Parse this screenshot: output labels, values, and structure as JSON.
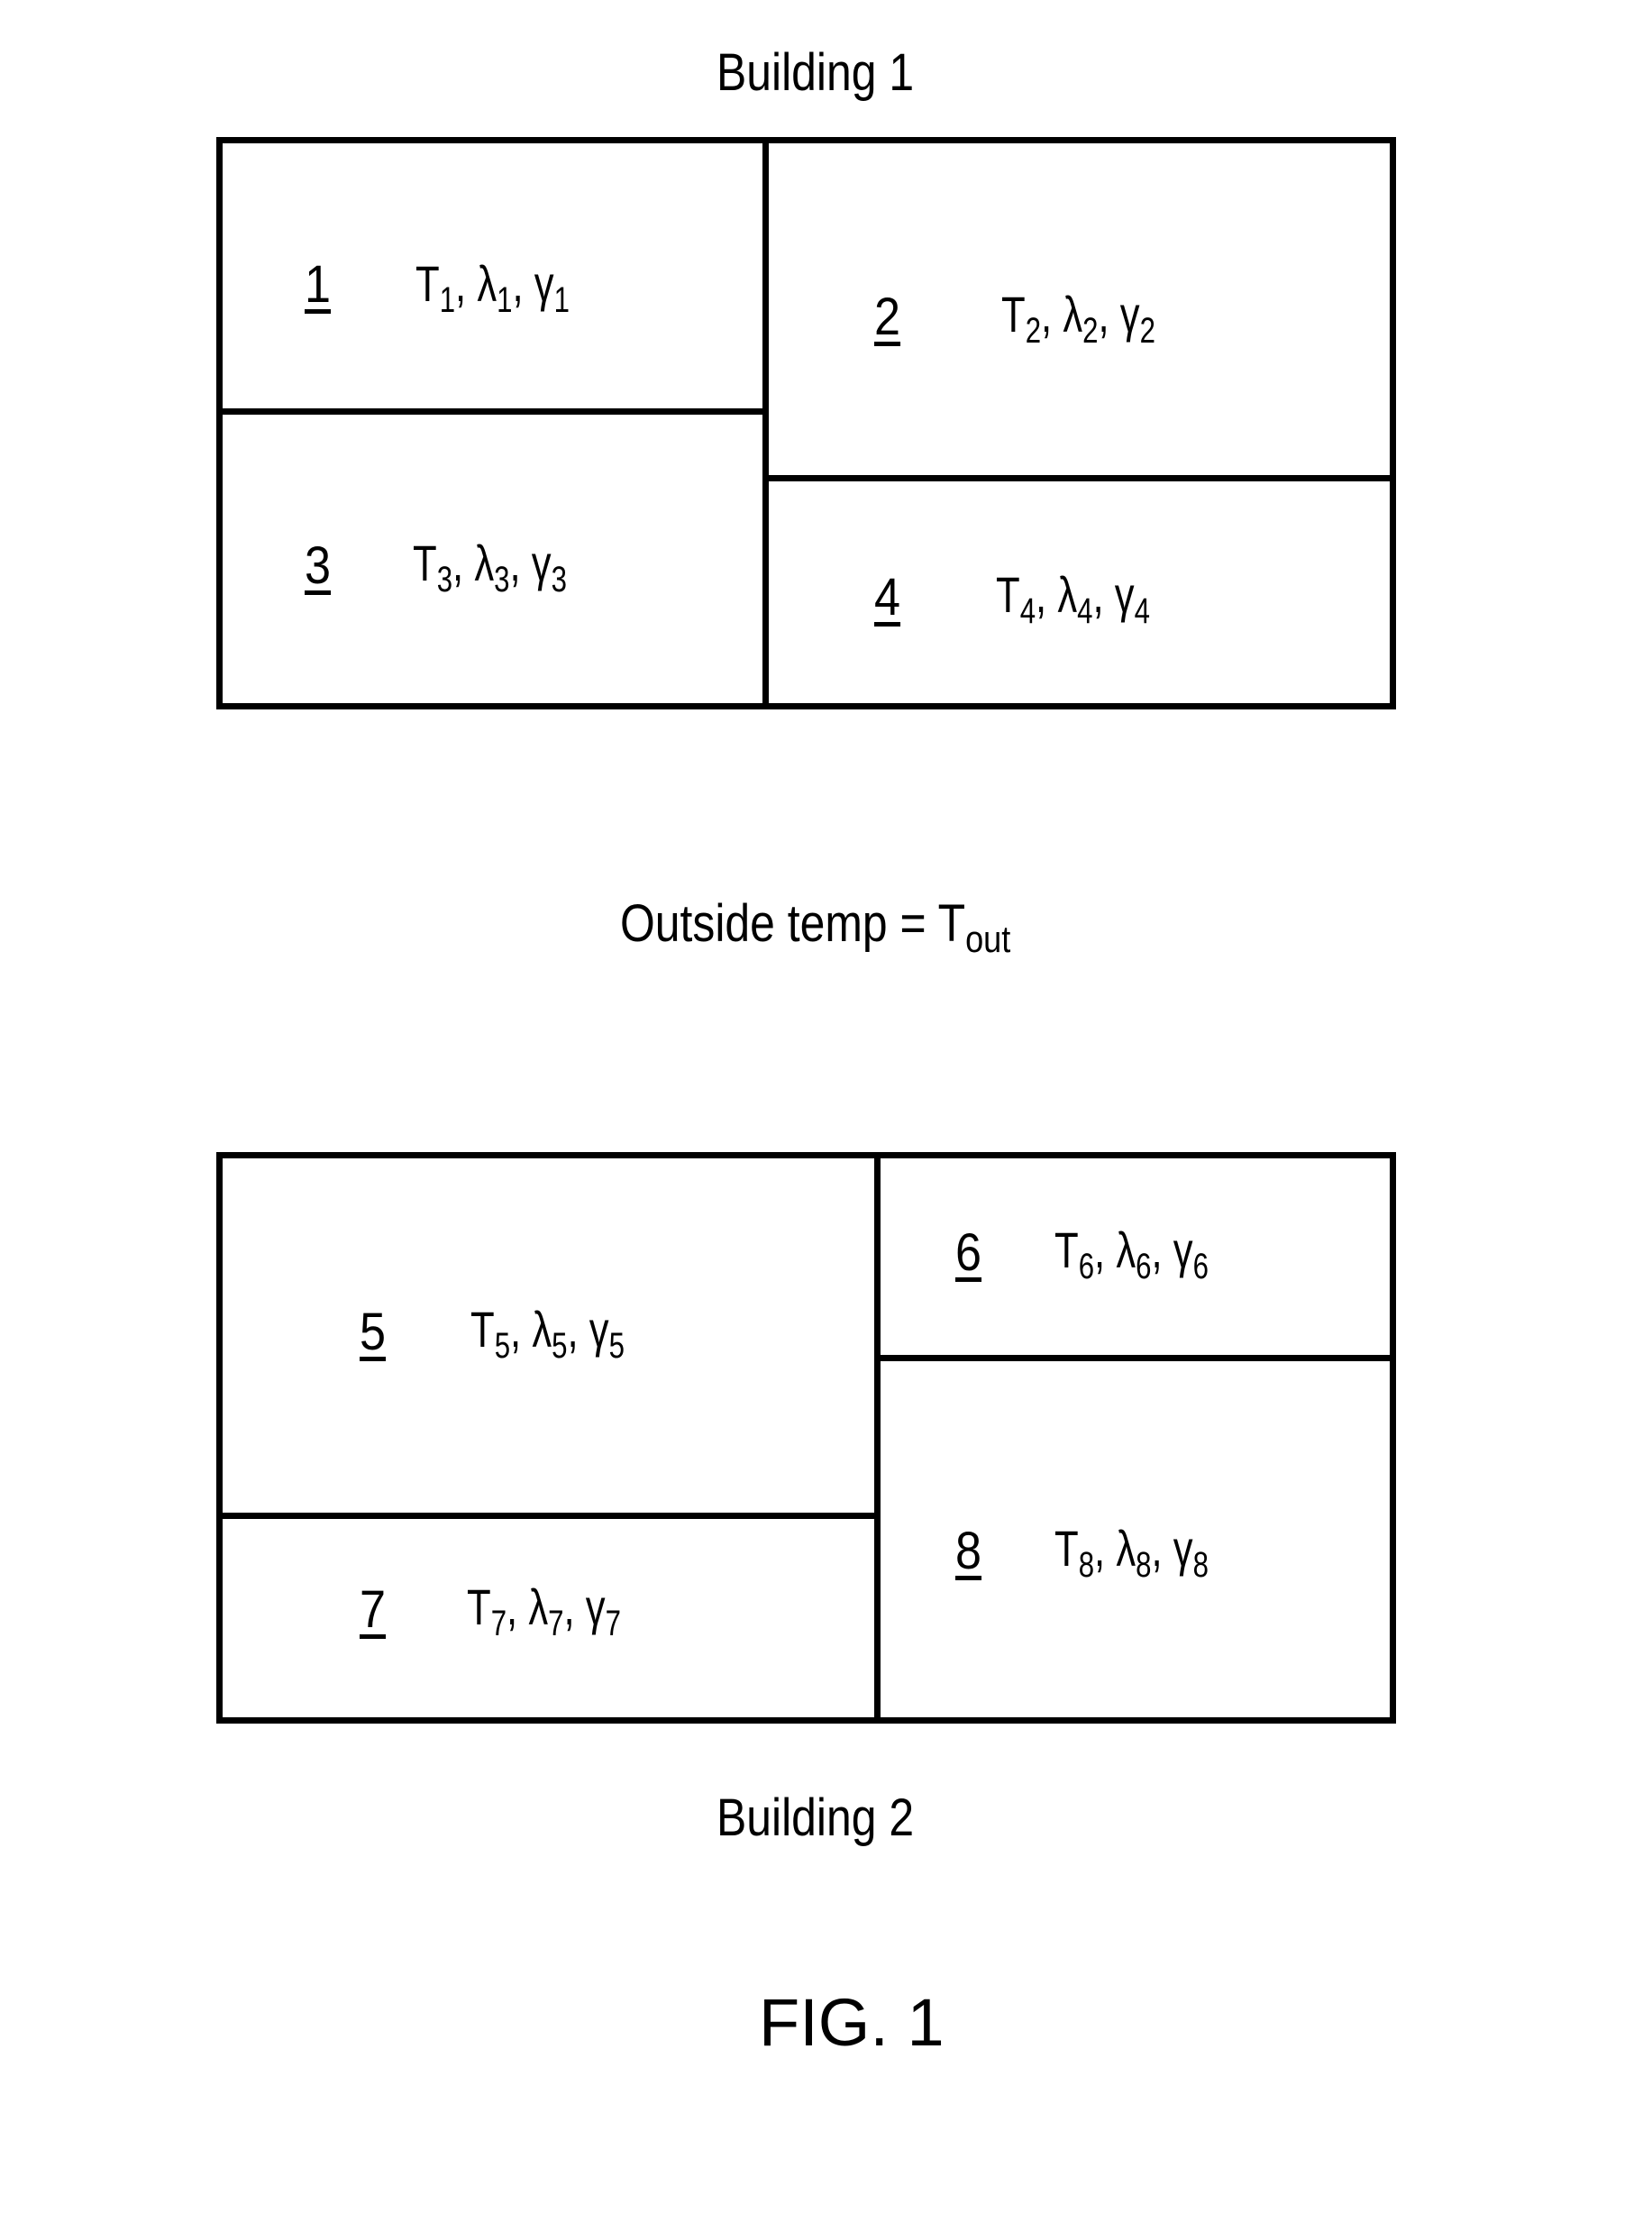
{
  "building1": {
    "title": "Building 1",
    "rooms": [
      {
        "id": "1",
        "var": "T",
        "lambda": "λ",
        "gamma": "γ",
        "sub": "1"
      },
      {
        "id": "2",
        "var": "T",
        "lambda": "λ",
        "gamma": "γ",
        "sub": "2"
      },
      {
        "id": "3",
        "var": "T",
        "lambda": "λ",
        "gamma": "γ",
        "sub": "3"
      },
      {
        "id": "4",
        "var": "T",
        "lambda": "λ",
        "gamma": "γ",
        "sub": "4"
      }
    ]
  },
  "outside": {
    "label": "Outside temp = T",
    "subscript": "out"
  },
  "building2": {
    "title": "Building 2",
    "rooms": [
      {
        "id": "5",
        "var": "T",
        "lambda": "λ",
        "gamma": "γ",
        "sub": "5"
      },
      {
        "id": "6",
        "var": "T",
        "lambda": "λ",
        "gamma": "γ",
        "sub": "6"
      },
      {
        "id": "7",
        "var": "T",
        "lambda": "λ",
        "gamma": "γ",
        "sub": "7"
      },
      {
        "id": "8",
        "var": "T",
        "lambda": "λ",
        "gamma": "γ",
        "sub": "8"
      }
    ]
  },
  "figure_label": "FIG. 1"
}
